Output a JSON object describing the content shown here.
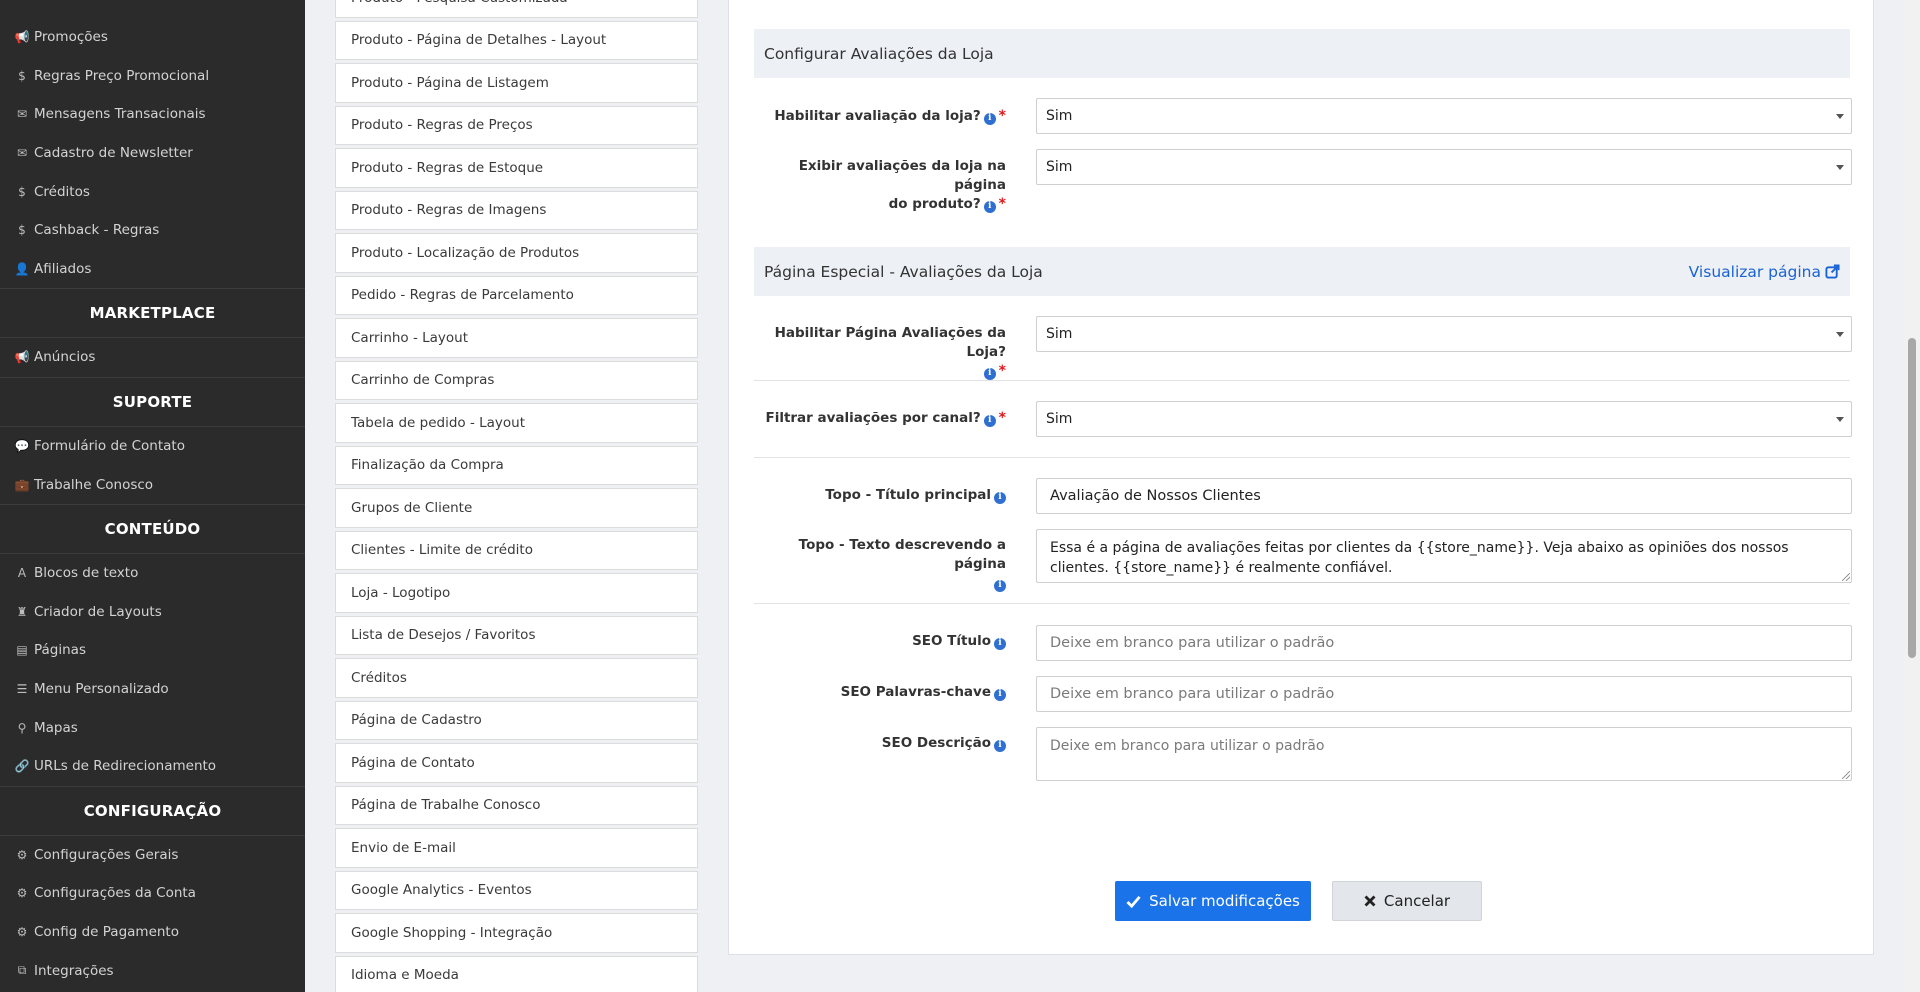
{
  "sidebar": {
    "items_top": [
      {
        "icon": "megaphone-icon",
        "glyph": "📢",
        "label": "Promoções"
      },
      {
        "icon": "dollar-icon",
        "glyph": "$",
        "label": "Regras Preço Promocional"
      },
      {
        "icon": "envelope-icon",
        "glyph": "✉",
        "label": "Mensagens Transacionais"
      },
      {
        "icon": "envelope-icon",
        "glyph": "✉",
        "label": "Cadastro de Newsletter"
      },
      {
        "icon": "dollar-icon",
        "glyph": "$",
        "label": "Créditos"
      },
      {
        "icon": "dollar-icon",
        "glyph": "$",
        "label": "Cashback - Regras"
      },
      {
        "icon": "user-icon",
        "glyph": "👤",
        "label": "Afiliados"
      }
    ],
    "marketplace_title": "MARKETPLACE",
    "marketplace_items": [
      {
        "icon": "bullhorn-icon",
        "glyph": "📢",
        "label": "Anúncios"
      }
    ],
    "suporte_title": "SUPORTE",
    "suporte_items": [
      {
        "icon": "comment-icon",
        "glyph": "💬",
        "label": "Formulário de Contato"
      },
      {
        "icon": "briefcase-icon",
        "glyph": "💼",
        "label": "Trabalhe Conosco"
      }
    ],
    "conteudo_title": "CONTEÚDO",
    "conteudo_items": [
      {
        "icon": "font-icon",
        "glyph": "A",
        "label": "Blocos de texto"
      },
      {
        "icon": "layout-icon",
        "glyph": "♜",
        "label": "Criador de Layouts"
      },
      {
        "icon": "file-icon",
        "glyph": "▤",
        "label": "Páginas"
      },
      {
        "icon": "list-icon",
        "glyph": "☰",
        "label": "Menu Personalizado"
      },
      {
        "icon": "map-marker-icon",
        "glyph": "⚲",
        "label": "Mapas"
      },
      {
        "icon": "link-icon",
        "glyph": "🔗",
        "label": "URLs de Redirecionamento"
      }
    ],
    "config_title": "CONFIGURAÇÃO",
    "config_items": [
      {
        "icon": "gear-icon",
        "glyph": "⚙",
        "label": "Configurações Gerais"
      },
      {
        "icon": "gear-icon",
        "glyph": "⚙",
        "label": "Configurações da Conta"
      },
      {
        "icon": "gear-icon",
        "glyph": "⚙",
        "label": "Config de Pagamento"
      },
      {
        "icon": "puzzle-icon",
        "glyph": "⧉",
        "label": "Integrações"
      }
    ]
  },
  "middle_menu": [
    "Produto - Pesquisa Customizada",
    "Produto - Página de Detalhes - Layout",
    "Produto - Página de Listagem",
    "Produto - Regras de Preços",
    "Produto - Regras de Estoque",
    "Produto - Regras de Imagens",
    "Produto - Localização de Produtos",
    "Pedido - Regras de Parcelamento",
    "Carrinho - Layout",
    "Carrinho de Compras",
    "Tabela de pedido - Layout",
    "Finalização da Compra",
    "Grupos de Cliente",
    "Clientes - Limite de crédito",
    "Loja - Logotipo",
    "Lista de Desejos / Favoritos",
    "Créditos",
    "Página de Cadastro",
    "Página de Contato",
    "Página de Trabalhe Conosco",
    "Envio de E-mail",
    "Google Analytics - Eventos",
    "Google Shopping - Integração",
    "Idioma e Moeda"
  ],
  "section1": {
    "title": "Configurar Avaliações da Loja",
    "habilitar_label": "Habilitar avaliação da loja?",
    "habilitar_value": "Sim",
    "exibir_label_1": "Exibir avaliações da loja na página",
    "exibir_label_2": "do produto?",
    "exibir_value": "Sim"
  },
  "section2": {
    "title": "Página Especial - Avaliações da Loja",
    "view_link": "Visualizar página",
    "habilitar_pagina_label": "Habilitar Página Avaliações da Loja?",
    "habilitar_pagina_value": "Sim",
    "filtrar_label": "Filtrar avaliações por canal?",
    "filtrar_value": "Sim",
    "titulo_label": "Topo - Título principal",
    "titulo_value": "Avaliação de Nossos Clientes",
    "texto_label_1": "Topo - Texto descrevendo a página",
    "texto_value": "Essa é a página de avaliações feitas por clientes da {{store_name}}. Veja abaixo as opiniões dos nossos clientes. {{store_name}} é realmente confiável.",
    "seo_titulo_label": "SEO Título",
    "seo_titulo_placeholder": "Deixe em branco para utilizar o padrão",
    "seo_palavras_label": "SEO Palavras-chave",
    "seo_palavras_placeholder": "Deixe em branco para utilizar o padrão",
    "seo_descricao_label": "SEO Descrição",
    "seo_descricao_placeholder": "Deixe em branco para utilizar o padrão"
  },
  "actions": {
    "save_label": "Salvar modificações",
    "cancel_label": "Cancelar"
  },
  "colors": {
    "sidebar_bg": "#2b2b2b",
    "primary": "#1a73e8",
    "link": "#1a63d6",
    "required": "#e0191b"
  }
}
